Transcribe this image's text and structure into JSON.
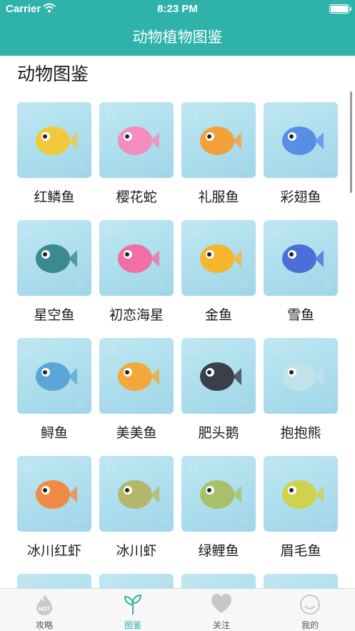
{
  "status_bar": {
    "carrier": "Carrier",
    "time": "8:23 PM"
  },
  "nav": {
    "title": "动物植物图鉴"
  },
  "section": {
    "title": "动物图鉴"
  },
  "animals": [
    {
      "name": "红鳞鱼",
      "color": "#f2c93b"
    },
    {
      "name": "樱花蛇",
      "color": "#f48cc0"
    },
    {
      "name": "礼服鱼",
      "color": "#f3a23a"
    },
    {
      "name": "彩翅鱼",
      "color": "#5a8de8"
    },
    {
      "name": "星空鱼",
      "color": "#3b8a8f"
    },
    {
      "name": "初恋海星",
      "color": "#ef6fa6"
    },
    {
      "name": "金鱼",
      "color": "#f6b52c"
    },
    {
      "name": "雪鱼",
      "color": "#4a6fd8"
    },
    {
      "name": "鲟鱼",
      "color": "#5ba6d6"
    },
    {
      "name": "美美鱼",
      "color": "#f3a83a"
    },
    {
      "name": "肥头鹅",
      "color": "#3a3f4a"
    },
    {
      "name": "抱抱熊",
      "color": "#bfe3e8"
    },
    {
      "name": "冰川红虾",
      "color": "#f08a45"
    },
    {
      "name": "冰川虾",
      "color": "#b5b86a"
    },
    {
      "name": "绿鲤鱼",
      "color": "#a8c06a"
    },
    {
      "name": "眉毛鱼",
      "color": "#cfd24a"
    },
    {
      "name": "",
      "color": "#e8526a"
    },
    {
      "name": "",
      "color": "#f2c6d8"
    },
    {
      "name": "",
      "color": "#bfe3e8"
    },
    {
      "name": "",
      "color": "#bfe3e8"
    }
  ],
  "tabs": [
    {
      "label": "攻略",
      "icon": "hot-flame-icon"
    },
    {
      "label": "图鉴",
      "icon": "sprout-icon",
      "active": true
    },
    {
      "label": "关注",
      "icon": "heart-icon"
    },
    {
      "label": "我的",
      "icon": "smile-face-icon"
    }
  ],
  "colors": {
    "accent": "#2fb2a9",
    "card_bg": "#a8dcec"
  }
}
